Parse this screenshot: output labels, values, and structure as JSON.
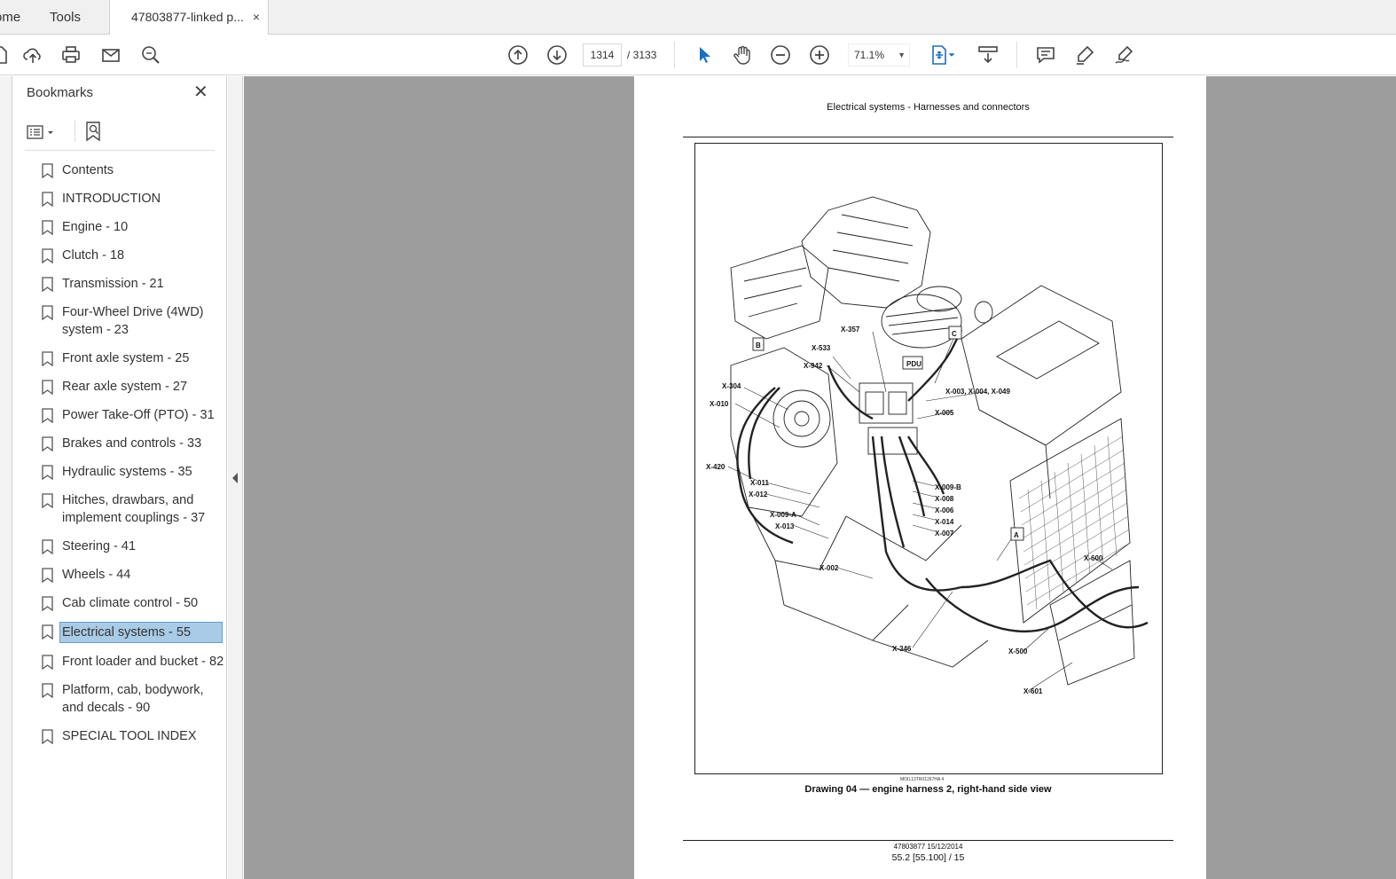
{
  "tabs": {
    "home": "ome",
    "tools": "Tools",
    "document": "47803877-linked p...",
    "close": "×"
  },
  "toolbar": {
    "page_current": "1314",
    "page_total": "/  3133",
    "zoom": "71.1%",
    "icons": [
      "new-file-icon",
      "upload-icon",
      "print-icon",
      "email-icon",
      "search-zoom-icon",
      "page-up-icon",
      "page-down-icon",
      "select-cursor-icon",
      "hand-icon",
      "zoom-out-icon",
      "zoom-in-icon",
      "fit-page-icon",
      "scroll-mode-icon",
      "comment-icon",
      "highlight-icon",
      "sign-icon"
    ]
  },
  "bookmarks": {
    "title": "Bookmarks",
    "close": "✕",
    "items": [
      "Contents",
      "INTRODUCTION",
      "Engine - 10",
      "Clutch - 18",
      "Transmission - 21",
      "Four-Wheel Drive (4WD) system - 23",
      "Front axle system - 25",
      "Rear axle system - 27",
      "Power Take-Off (PTO) - 31",
      "Brakes and controls - 33",
      "Hydraulic systems - 35",
      "Hitches, drawbars, and implement couplings - 37",
      "Steering - 41",
      "Wheels - 44",
      "Cab climate control - 50",
      "Electrical systems - 55",
      "Front loader and bucket - 82",
      "Platform, cab, bodywork, and decals - 90",
      "SPECIAL TOOL INDEX"
    ],
    "selected_index": 15
  },
  "document": {
    "header": "Electrical systems - Harnesses and connectors",
    "figure_code": "MOIL13TR01267HA   4",
    "caption": "Drawing 04 — engine harness 2, right-hand side view",
    "footer_line1": "47803877 15/12/2014",
    "footer_line2": "55.2 [55.100] / 15",
    "labels": [
      "X-357",
      "C",
      "X-533",
      "PDU",
      "B",
      "X-942",
      "X-304",
      "X-003, X-004, X-049",
      "X-010",
      "X-005",
      "X-420",
      "X-011",
      "X-012",
      "X-009-B",
      "X-008",
      "X-006",
      "X-014",
      "X-007",
      "X-009-A",
      "X-013",
      "A",
      "X-600",
      "X-002",
      "X-346",
      "X-500",
      "X-601"
    ]
  },
  "colors": {
    "selection": "#a9cbe6",
    "viewport_bg": "#9d9d9d",
    "accent_blue": "#1a6fc2"
  }
}
